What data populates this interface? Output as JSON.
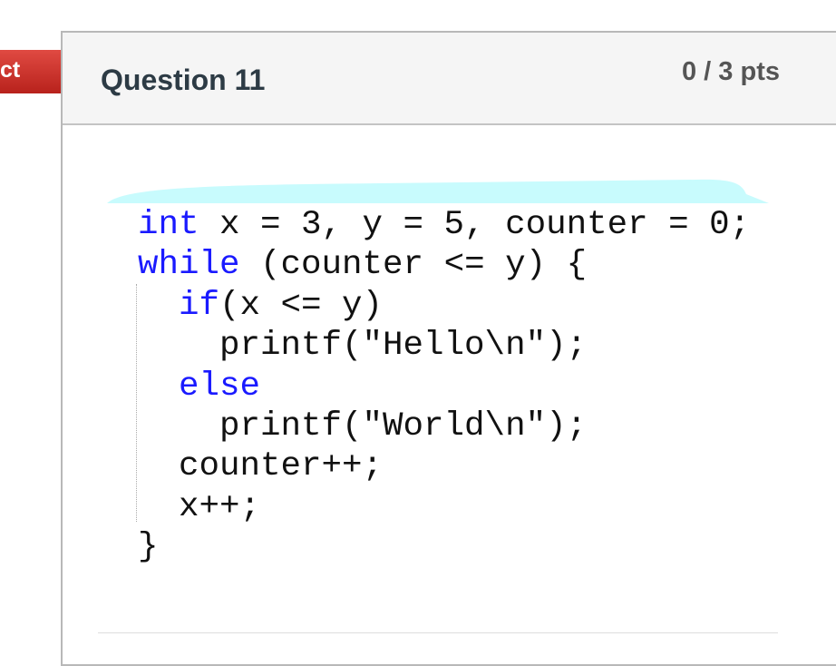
{
  "badge": {
    "label": "ct",
    "color": "#d03a32"
  },
  "question": {
    "title": "Question 11",
    "points": "0 / 3 pts"
  },
  "code": {
    "lines": [
      {
        "kw": "int",
        "rest": " x = 3, y = 5, counter = 0;"
      },
      {
        "kw": "while",
        "rest": " (counter <= y) {"
      },
      {
        "kw": "  if",
        "rest": "(x <= y)"
      },
      {
        "kw": "",
        "rest": "    printf(\"Hello\\n\");"
      },
      {
        "kw": "  else",
        "rest": ""
      },
      {
        "kw": "",
        "rest": "    printf(\"World\\n\");"
      },
      {
        "kw": "",
        "rest": "  counter++;"
      },
      {
        "kw": "",
        "rest": "  x++;"
      },
      {
        "kw": "",
        "rest": "}"
      }
    ]
  }
}
